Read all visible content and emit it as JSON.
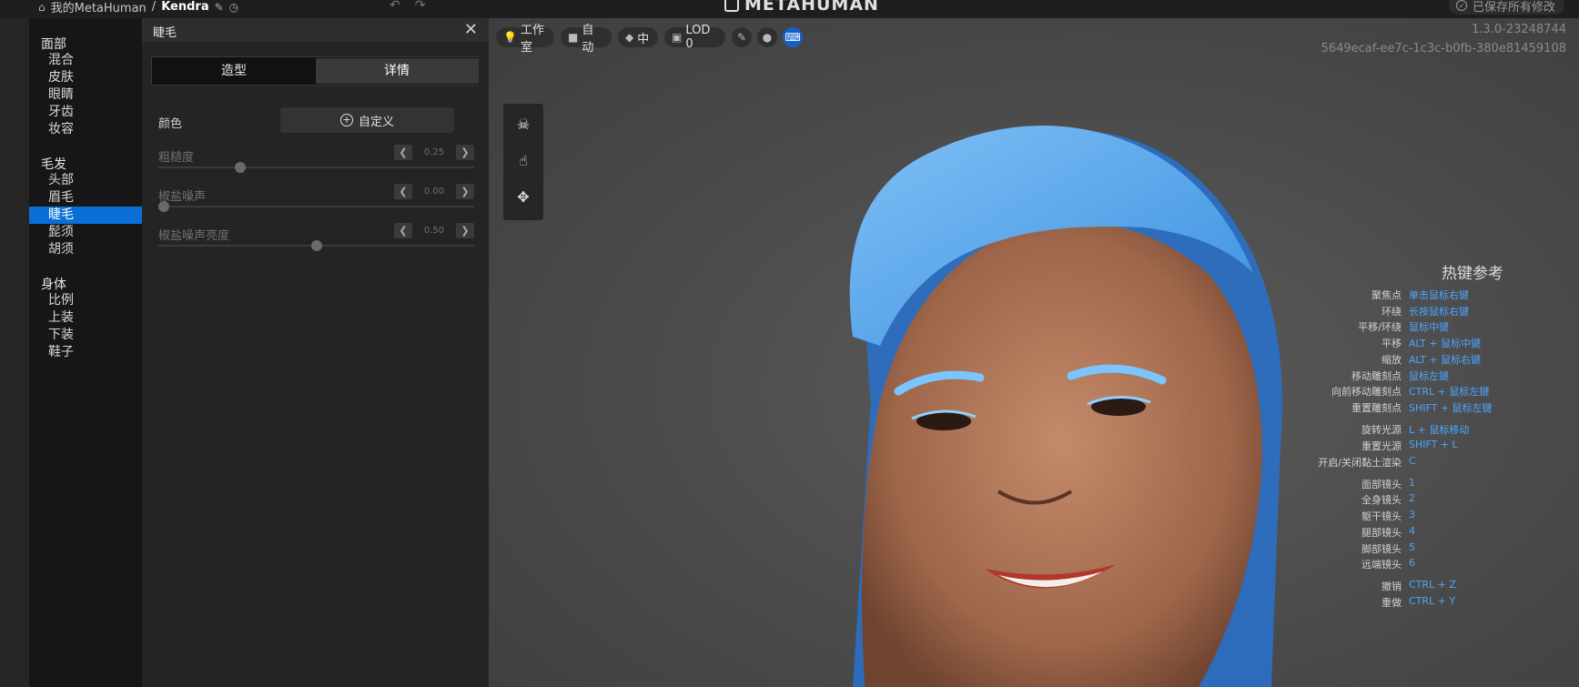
{
  "topbar": {
    "home": "我的MetaHuman",
    "sep": "/",
    "name": "Kendra",
    "logo": "METAHUMAN",
    "saved": "已保存所有修改"
  },
  "nav": {
    "sections": [
      {
        "title": "面部",
        "items": [
          "混合",
          "皮肤",
          "眼睛",
          "牙齿",
          "妆容"
        ]
      },
      {
        "title": "毛发",
        "items": [
          "头部",
          "眉毛",
          "睫毛",
          "髭须",
          "胡须"
        ]
      },
      {
        "title": "身体",
        "items": [
          "比例",
          "上装",
          "下装",
          "鞋子"
        ]
      }
    ],
    "active": "睫毛"
  },
  "panel": {
    "title": "睫毛",
    "tabs": [
      "造型",
      "详情"
    ],
    "active_tab": "详情",
    "color_label": "颜色",
    "custom_label": "自定义",
    "sliders": [
      {
        "label": "粗糙度",
        "value": "0.25",
        "fraction": 0.25
      },
      {
        "label": "椒盐噪声",
        "value": "0.00",
        "fraction": 0.0
      },
      {
        "label": "椒盐噪声亮度",
        "value": "0.50",
        "fraction": 0.5
      }
    ]
  },
  "viewport": {
    "toolbar": {
      "studio": "工作室",
      "camera": "自动",
      "quality": "中",
      "lod": "LOD 0"
    },
    "version": "1.3.0-23248744",
    "id": "5649ecaf-ee7c-1c3c-b0fb-380e81459108",
    "hotkeys": {
      "title": "热键参考",
      "groups": [
        [
          {
            "k": "聚焦点",
            "v": "单击鼠标右键"
          },
          {
            "k": "环绕",
            "v": "长按鼠标右键"
          },
          {
            "k": "平移/环绕",
            "v": "鼠标中键"
          },
          {
            "k": "平移",
            "v": "ALT + 鼠标中键"
          },
          {
            "k": "缩放",
            "v": "ALT + 鼠标右键"
          },
          {
            "k": "移动雕刻点",
            "v": "鼠标左键"
          },
          {
            "k": "向前移动雕刻点",
            "v": "CTRL + 鼠标左键"
          },
          {
            "k": "重置雕刻点",
            "v": "SHIFT + 鼠标左键"
          }
        ],
        [
          {
            "k": "旋转光源",
            "v": "L + 鼠标移动"
          },
          {
            "k": "重置光源",
            "v": "SHIFT + L"
          },
          {
            "k": "开启/关闭黏土渲染",
            "v": "C"
          }
        ],
        [
          {
            "k": "面部镜头",
            "v": "1"
          },
          {
            "k": "全身镜头",
            "v": "2"
          },
          {
            "k": "躯干镜头",
            "v": "3"
          },
          {
            "k": "腿部镜头",
            "v": "4"
          },
          {
            "k": "脚部镜头",
            "v": "5"
          },
          {
            "k": "远端镜头",
            "v": "6"
          }
        ],
        [
          {
            "k": "撤销",
            "v": "CTRL + Z"
          },
          {
            "k": "重做",
            "v": "CTRL + Y"
          }
        ]
      ]
    }
  }
}
